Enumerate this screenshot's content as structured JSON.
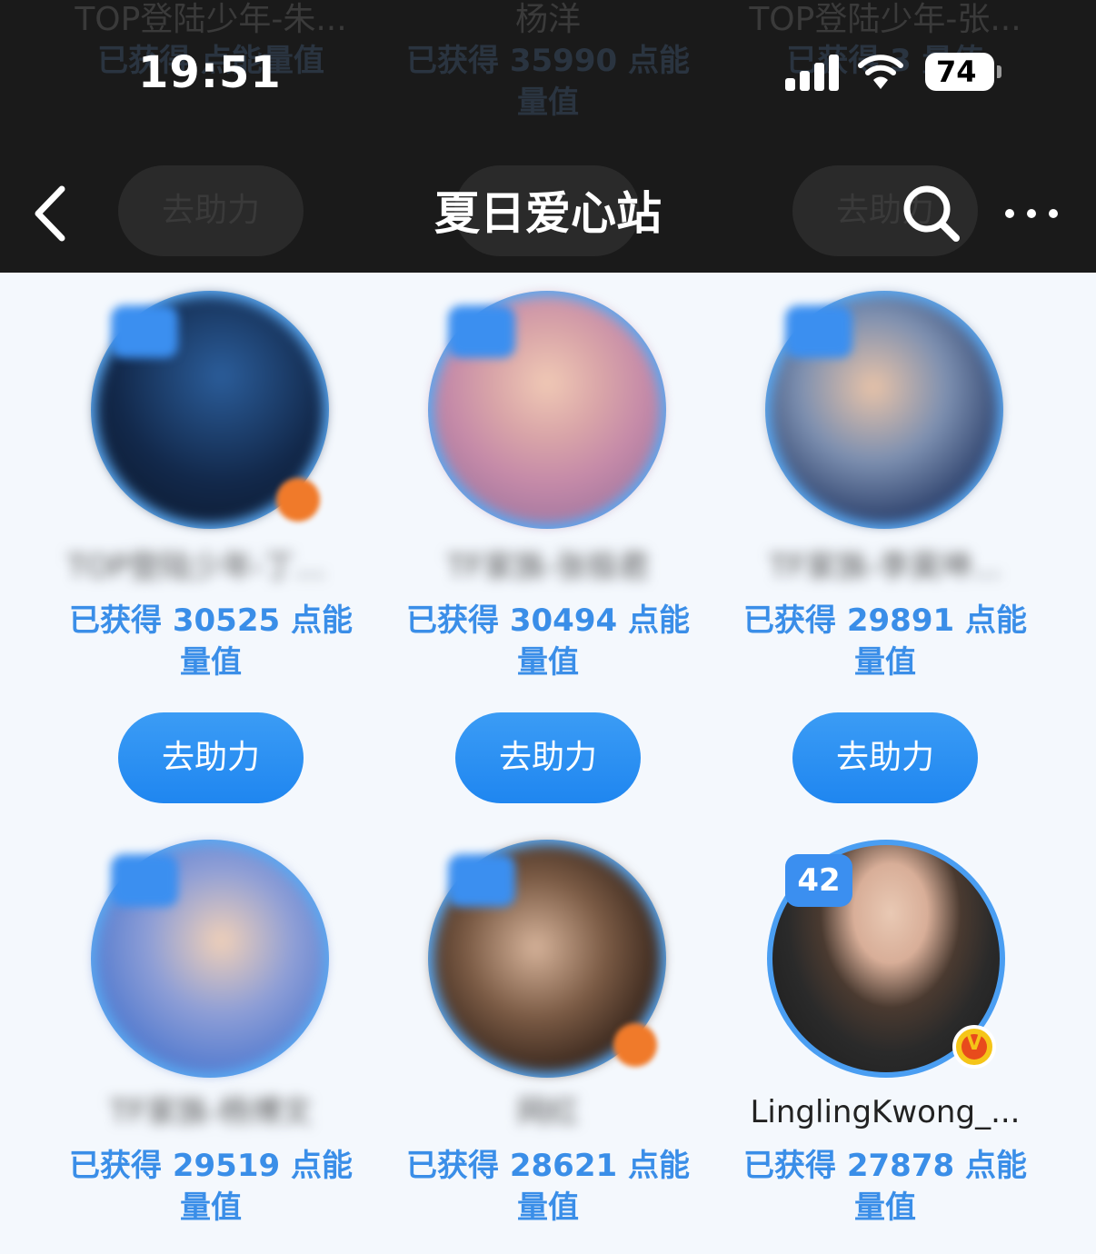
{
  "status_bar": {
    "time": "19:51",
    "battery": "74"
  },
  "nav": {
    "title": "夏日爱心站"
  },
  "ghost_row": [
    {
      "name": "TOP登陆少年-朱...",
      "energy": "已获得 点能量值",
      "button": "去助力"
    },
    {
      "name": "杨洋",
      "energy": "已获得 35990 点能量值",
      "button": ""
    },
    {
      "name": "TOP登陆少年-张...",
      "energy": "已获得 3 量值",
      "button": "去助力"
    }
  ],
  "cards": [
    {
      "name": "TOP登陆少年-丁程鑫",
      "energy": "已获得 30525 点能量值",
      "button": "去助力"
    },
    {
      "name": "TF家族-张极君",
      "energy": "已获得 30494 点能量值",
      "button": "去助力"
    },
    {
      "name": "TF家族-李昊坤...",
      "energy": "已获得 29891 点能量值",
      "button": "去助力"
    },
    {
      "name": "TF家族-杨博文",
      "energy": "已获得 29519 点能量值"
    },
    {
      "name": "网红",
      "energy": "已获得 28621 点能量值"
    },
    {
      "name": "LinglingKwong_...",
      "energy": "已获得 27878 点能量值",
      "level": "42",
      "verified_mark": "V"
    }
  ],
  "colors": {
    "accent": "#3a8ee8",
    "button": "#1f86f0",
    "header_bg": "#1a1a1a",
    "page_bg": "#f4f8fd"
  }
}
